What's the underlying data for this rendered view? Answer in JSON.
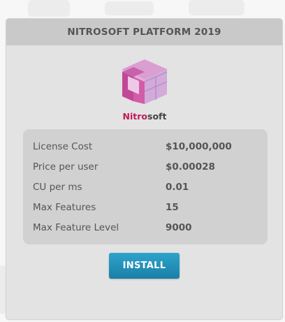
{
  "window": {
    "title": "NITROSOFT PLATFORM 2019"
  },
  "product": {
    "brand_accent": "Nitro",
    "brand_rest": "soft",
    "logo_icon": "nitrosoft-cube-logo-icon"
  },
  "specs": [
    {
      "label": "License Cost",
      "value": "$10,000,000"
    },
    {
      "label": "Price per user",
      "value": "$0.00028"
    },
    {
      "label": "CU per ms",
      "value": "0.01"
    },
    {
      "label": "Max Features",
      "value": "15"
    },
    {
      "label": "Max Feature Level",
      "value": "9000"
    }
  ],
  "actions": {
    "install_label": "INSTALL"
  },
  "colors": {
    "brand_magenta": "#c2185b",
    "install_button": "#1f8bb5",
    "header_bg": "#c9c9c9",
    "panel_bg": "#e3e3e3",
    "specs_bg": "#d1d1d1"
  }
}
